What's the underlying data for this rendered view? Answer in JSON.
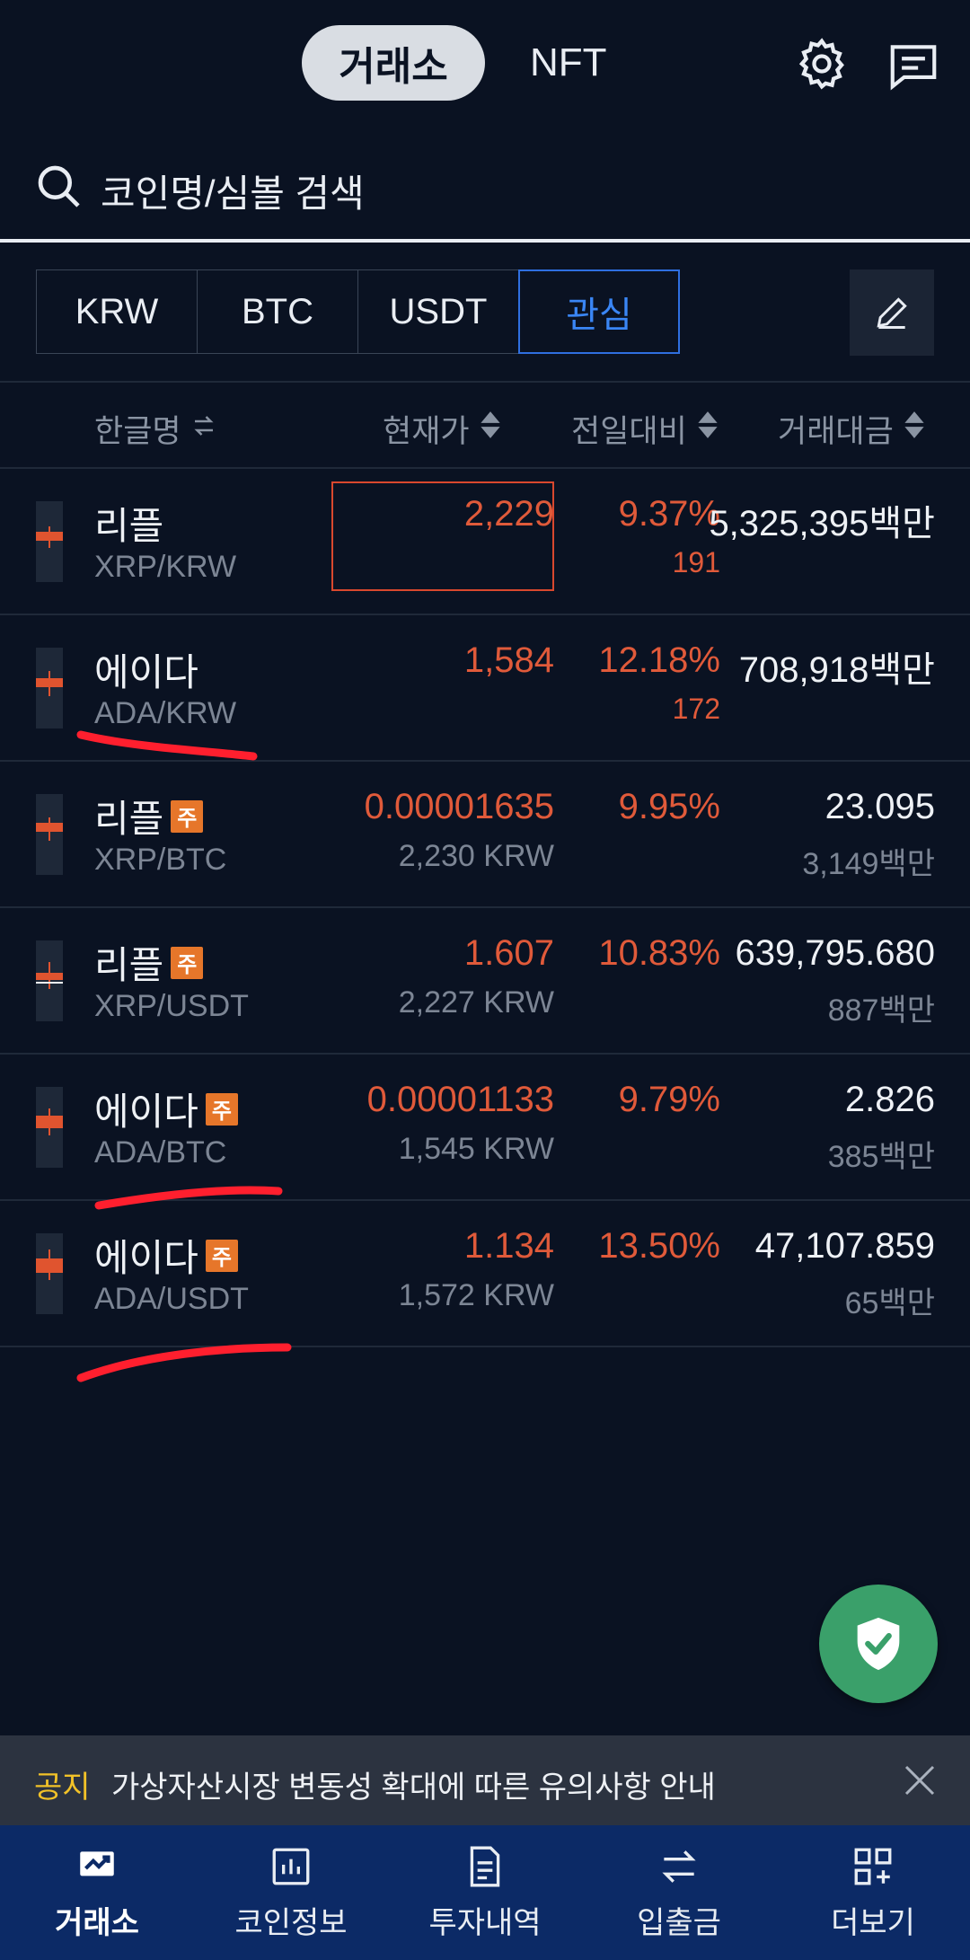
{
  "header": {
    "tab_exchange": "거래소",
    "tab_nft": "NFT",
    "settings_icon": "gear-icon",
    "message_icon": "message-icon"
  },
  "search": {
    "placeholder": "코인명/심볼 검색"
  },
  "market_tabs": [
    {
      "label": "KRW",
      "active": false
    },
    {
      "label": "BTC",
      "active": false
    },
    {
      "label": "USDT",
      "active": false
    },
    {
      "label": "관심",
      "active": true
    }
  ],
  "columns": {
    "name": "한글명",
    "price": "현재가",
    "change": "전일대비",
    "volume": "거래대금"
  },
  "rows": [
    {
      "name": "리플",
      "badge": "",
      "pair": "XRP/KRW",
      "price": "2,229",
      "price_sub": "",
      "change": "9.37%",
      "change_sub": "191",
      "volume": "5,325,395백만",
      "volume_sub": ""
    },
    {
      "name": "에이다",
      "badge": "",
      "pair": "ADA/KRW",
      "price": "1,584",
      "price_sub": "",
      "change": "12.18%",
      "change_sub": "172",
      "volume": "708,918백만",
      "volume_sub": ""
    },
    {
      "name": "리플",
      "badge": "주",
      "pair": "XRP/BTC",
      "price": "0.00001635",
      "price_sub": "2,230 KRW",
      "change": "9.95%",
      "change_sub": "",
      "volume": "23.095",
      "volume_sub": "3,149백만"
    },
    {
      "name": "리플",
      "badge": "주",
      "pair": "XRP/USDT",
      "price": "1.607",
      "price_sub": "2,227 KRW",
      "change": "10.83%",
      "change_sub": "",
      "volume": "639,795.680",
      "volume_sub": "887백만"
    },
    {
      "name": "에이다",
      "badge": "주",
      "pair": "ADA/BTC",
      "price": "0.00001133",
      "price_sub": "1,545 KRW",
      "change": "9.79%",
      "change_sub": "",
      "volume": "2.826",
      "volume_sub": "385백만"
    },
    {
      "name": "에이다",
      "badge": "주",
      "pair": "ADA/USDT",
      "price": "1.134",
      "price_sub": "1,572 KRW",
      "change": "13.50%",
      "change_sub": "",
      "volume": "47,107.859",
      "volume_sub": "65백만"
    }
  ],
  "notice": {
    "label": "공지",
    "text": "가상자산시장 변동성 확대에 따른 유의사항 안내"
  },
  "bottom_nav": [
    {
      "label": "거래소",
      "icon": "chart-up-icon",
      "active": true
    },
    {
      "label": "코인정보",
      "icon": "bar-chart-icon",
      "active": false
    },
    {
      "label": "투자내역",
      "icon": "document-icon",
      "active": false
    },
    {
      "label": "입출금",
      "icon": "transfer-icon",
      "active": false
    },
    {
      "label": "더보기",
      "icon": "grid-plus-icon",
      "active": false
    }
  ],
  "colors": {
    "background": "#0a1222",
    "up_red": "#e05a3a",
    "accent_blue": "#3a86f5",
    "nav_bg": "#0c2a66",
    "security_green": "#3aa06a",
    "notice_yellow": "#f2c228",
    "annotation_red": "#ff1f2e"
  }
}
